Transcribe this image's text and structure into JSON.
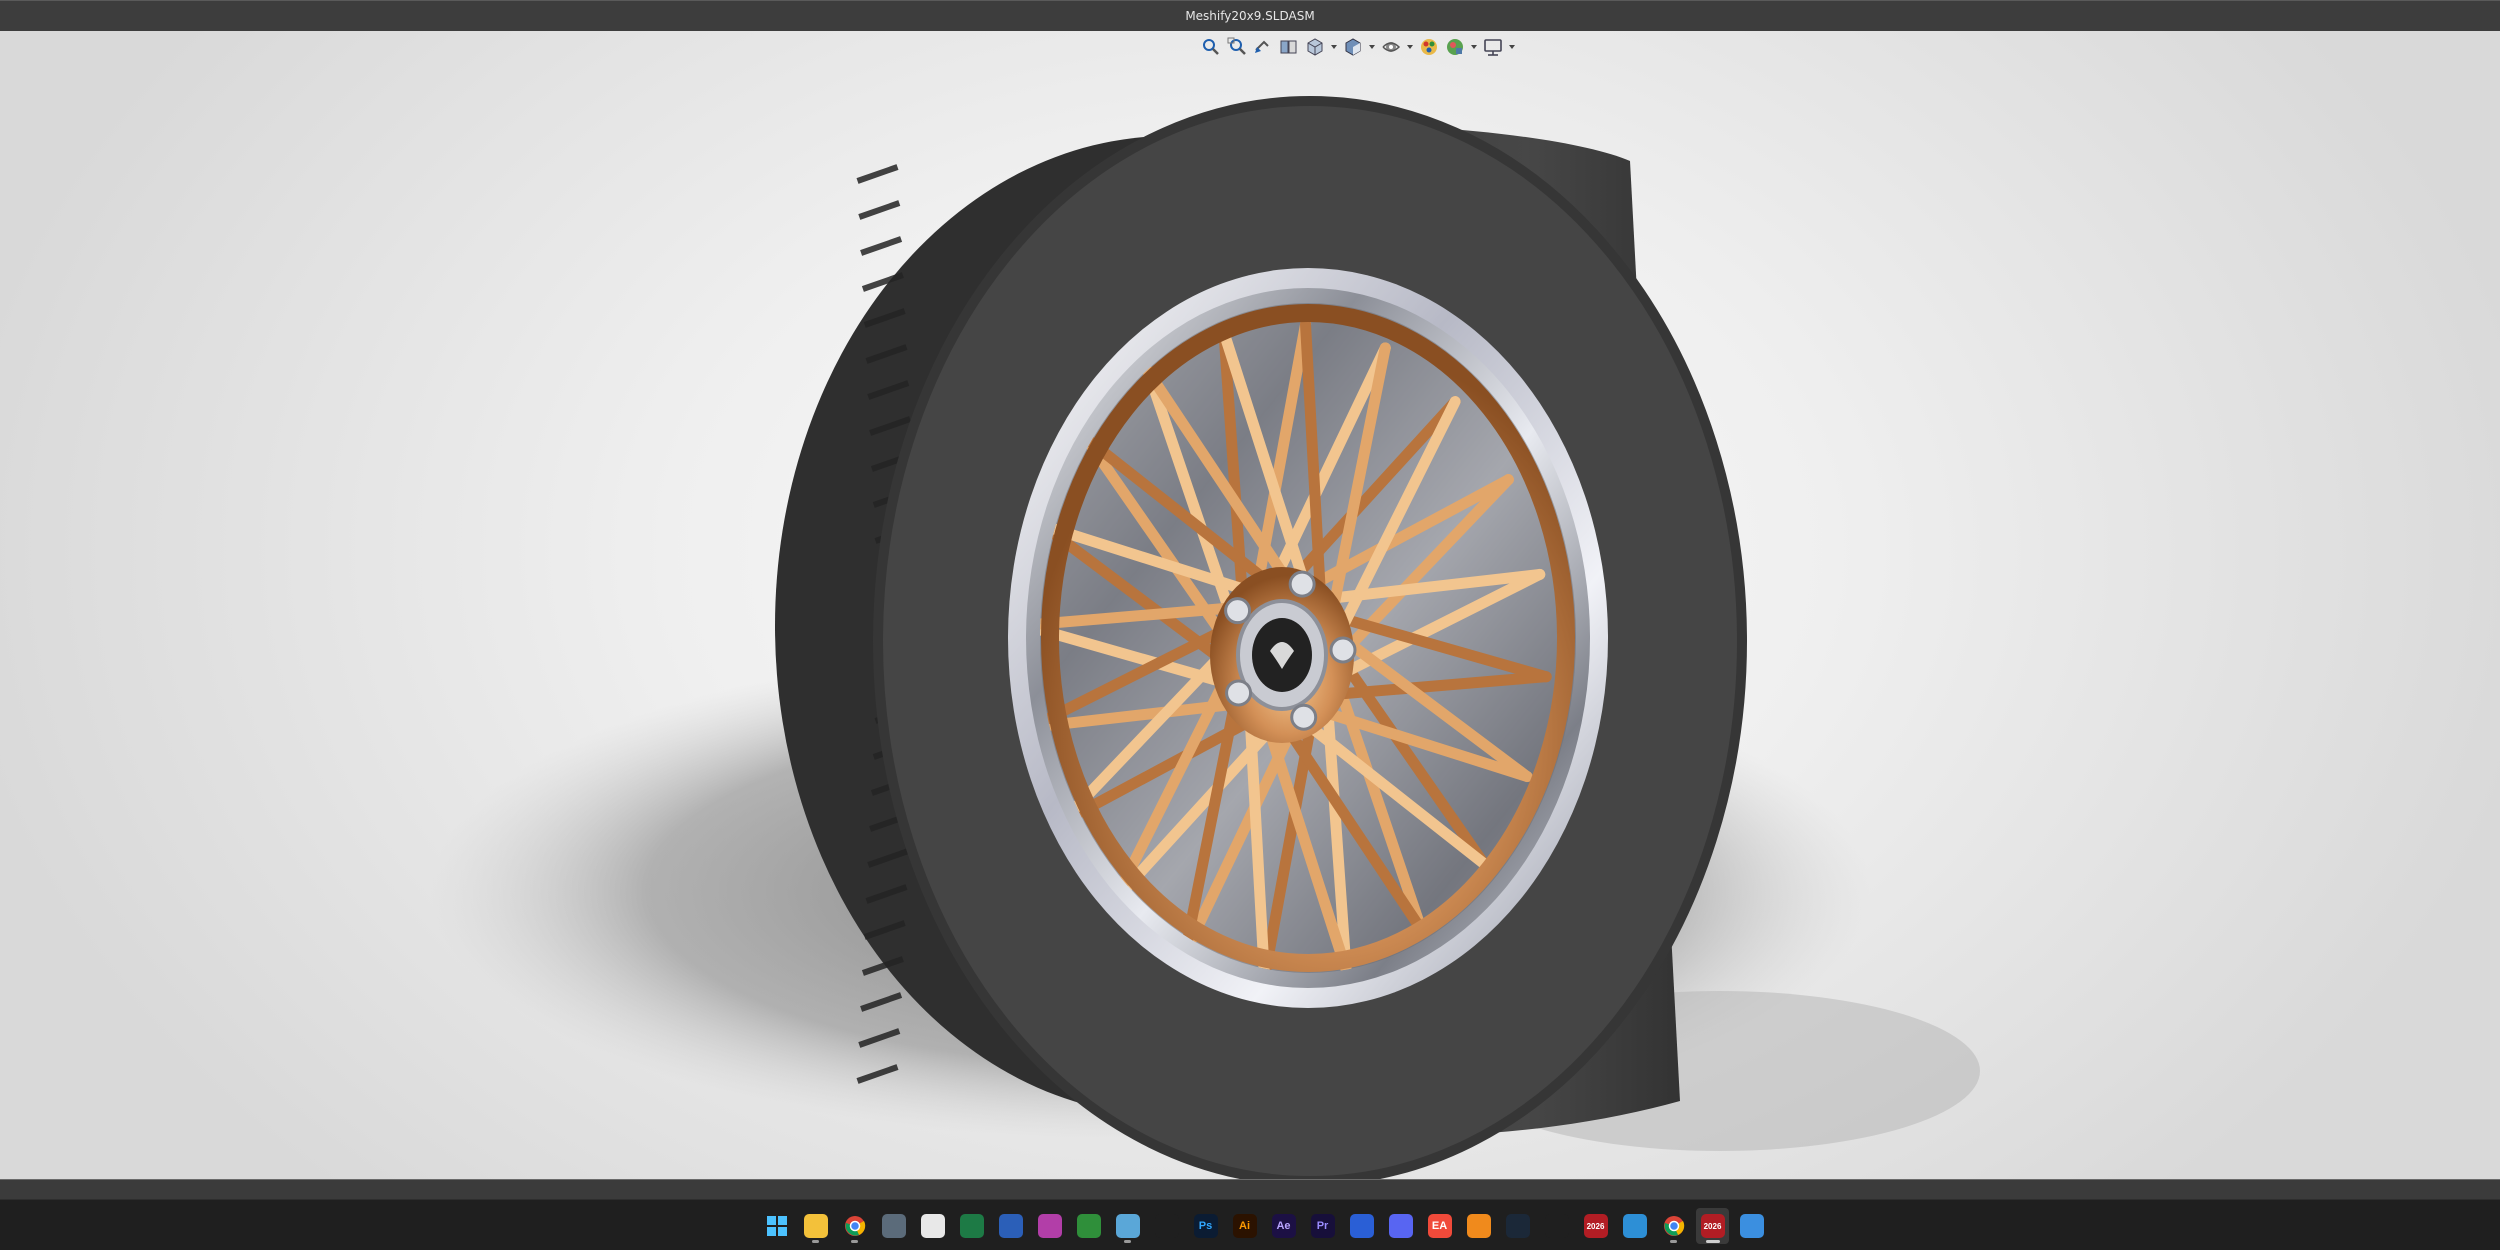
{
  "window": {
    "title": "Meshify20x9.SLDASM"
  },
  "heads_up_toolbar": {
    "items": [
      {
        "icon": "zoom-to-fit-icon",
        "dropdown": false
      },
      {
        "icon": "zoom-to-area-icon",
        "dropdown": false
      },
      {
        "icon": "previous-view-icon",
        "dropdown": false
      },
      {
        "icon": "section-view-icon",
        "dropdown": false
      },
      {
        "icon": "view-orientation-icon",
        "dropdown": true
      },
      {
        "icon": "display-style-icon",
        "dropdown": true
      },
      {
        "icon": "hide-show-items-icon",
        "dropdown": true
      },
      {
        "icon": "edit-appearance-icon",
        "dropdown": false
      },
      {
        "icon": "apply-scene-icon",
        "dropdown": true
      },
      {
        "icon": "view-settings-icon",
        "dropdown": true
      }
    ]
  },
  "viewport": {
    "model_description": "wheel-and-tire-assembly",
    "colors": {
      "tire": "#3e3e3e",
      "rim_bronze": "#c98a4e",
      "lip_chrome": "#d7d9e2",
      "background": "#efefef"
    }
  },
  "taskbar": {
    "items": [
      {
        "icon": "windows-start-icon",
        "label": "",
        "bg": "#1f1f1f",
        "fg": "#4cc2ff",
        "running": false
      },
      {
        "icon": "file-explorer-icon",
        "label": "",
        "bg": "#f3c13a",
        "fg": "#ffffff",
        "running": true
      },
      {
        "icon": "chrome-icon",
        "label": "",
        "bg": "#1f1f1f",
        "fg": "#ffffff",
        "running": true
      },
      {
        "icon": "calculator-icon",
        "label": "",
        "bg": "#5b6b7a",
        "fg": "#ffffff",
        "running": false
      },
      {
        "icon": "microsoft-store-icon",
        "label": "",
        "bg": "#e8e8e8",
        "fg": "#333333",
        "running": false
      },
      {
        "icon": "excel-icon",
        "label": "",
        "bg": "#1d7a45",
        "fg": "#ffffff",
        "running": false
      },
      {
        "icon": "word-icon",
        "label": "",
        "bg": "#2b5fb8",
        "fg": "#ffffff",
        "running": false
      },
      {
        "icon": "instagram-icon",
        "label": "",
        "bg": "#b23ea8",
        "fg": "#ffffff",
        "running": false
      },
      {
        "icon": "xbox-icon",
        "label": "",
        "bg": "#2f8f3a",
        "fg": "#ffffff",
        "running": false
      },
      {
        "icon": "notepad-icon",
        "label": "",
        "bg": "#5aa7d8",
        "fg": "#ffffff",
        "running": true
      },
      {
        "icon": "nvidia-icon",
        "label": "",
        "bg": "#1f1f1f",
        "fg": "#76b900",
        "running": false
      },
      {
        "icon": "photoshop-icon",
        "label": "Ps",
        "bg": "#0b1c33",
        "fg": "#31a8ff",
        "running": false
      },
      {
        "icon": "illustrator-icon",
        "label": "Ai",
        "bg": "#2b1200",
        "fg": "#ff9a00",
        "running": false
      },
      {
        "icon": "after-effects-icon",
        "label": "Ae",
        "bg": "#1c1044",
        "fg": "#b9a4ff",
        "running": false
      },
      {
        "icon": "premiere-pro-icon",
        "label": "Pr",
        "bg": "#170f3a",
        "fg": "#9a8cff",
        "running": false
      },
      {
        "icon": "mail-icon",
        "label": "",
        "bg": "#2a5fd6",
        "fg": "#ffffff",
        "running": false
      },
      {
        "icon": "discord-icon",
        "label": "",
        "bg": "#5865f2",
        "fg": "#ffffff",
        "running": false
      },
      {
        "icon": "ea-app-icon",
        "label": "EA",
        "bg": "#f04a3a",
        "fg": "#ffffff",
        "running": false
      },
      {
        "icon": "fusion-icon",
        "label": "",
        "bg": "#f08a1c",
        "fg": "#ffffff",
        "running": false
      },
      {
        "icon": "steam-icon",
        "label": "",
        "bg": "#1b2838",
        "fg": "#c7d5e0",
        "running": false
      },
      {
        "icon": "blender-icon",
        "label": "",
        "bg": "#1f1f1f",
        "fg": "#f5792a",
        "running": false
      },
      {
        "icon": "solidworks-2026-icon",
        "label": "2026",
        "bg": "#b21d24",
        "fg": "#ffffff",
        "running": false
      },
      {
        "icon": "3d-viewer-icon",
        "label": "",
        "bg": "#2d8fd6",
        "fg": "#ffffff",
        "running": false
      },
      {
        "icon": "chrome-profile-icon",
        "label": "",
        "bg": "#1f1f1f",
        "fg": "#ffffff",
        "running": true
      },
      {
        "icon": "solidworks-2026-active-icon",
        "label": "2026",
        "bg": "#b21d24",
        "fg": "#ffffff",
        "running": true,
        "active": true
      },
      {
        "icon": "notes-icon",
        "label": "",
        "bg": "#3b8fe0",
        "fg": "#ffffff",
        "running": false
      }
    ]
  }
}
